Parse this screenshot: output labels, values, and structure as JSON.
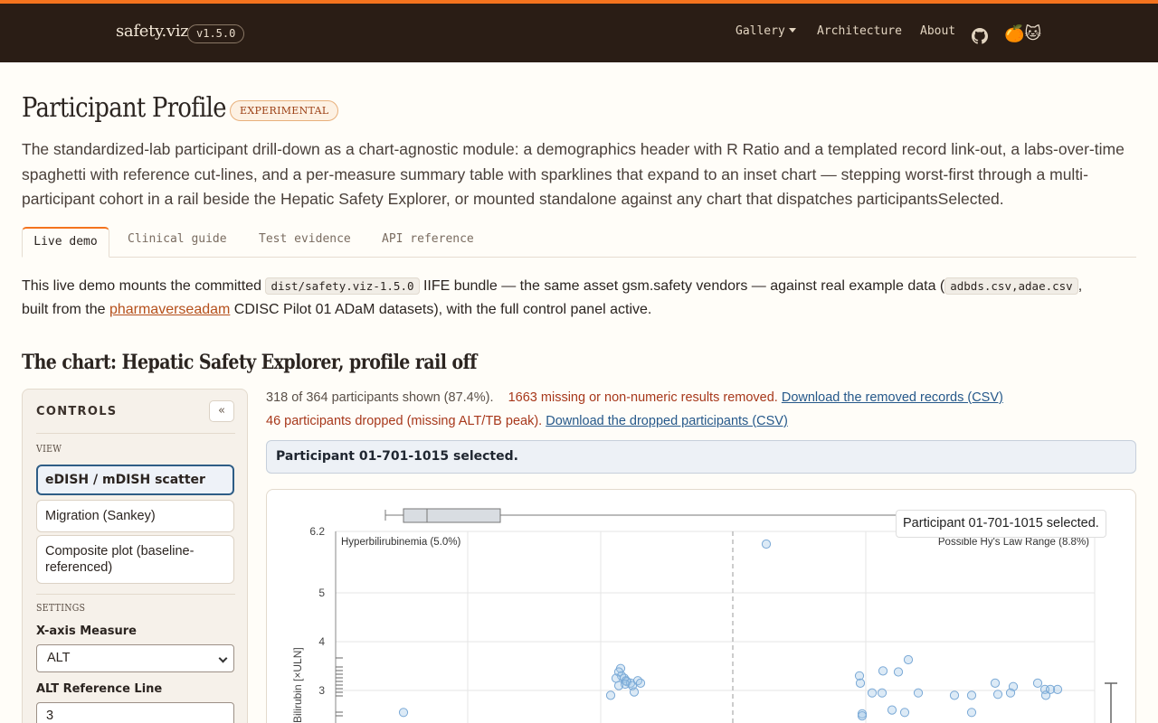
{
  "nav": {
    "brand": "safety.viz",
    "version": "v1.5.0",
    "links": [
      "Gallery",
      "Architecture",
      "About"
    ],
    "github_icon": "github-icon",
    "emoji": "🍊🐱"
  },
  "header": {
    "title": "Participant Profile",
    "badge": "EXPERIMENTAL",
    "lede": "The standardized-lab participant drill-down as a chart-agnostic module: a demographics header with R Ratio and a templated record link-out, a labs-over-time spaghetti with reference cut-lines, and a per-measure summary table with sparklines that expand to an inset chart — stepping worst-first through a multi-participant cohort in a rail beside the Hepatic Safety Explorer, or mounted standalone against any chart that dispatches participantsSelected."
  },
  "tabs": [
    "Live demo",
    "Clinical guide",
    "Test evidence",
    "API reference"
  ],
  "intro": {
    "p1_a": "This live demo mounts the committed",
    "code1": "dist/safety.viz-1.5.0",
    "p1_b": "IIFE bundle — the same asset gsm.safety vendors — against real example data (",
    "code2": "adbds.csv,adae.csv",
    "p1_c": ",",
    "p2_a": "built from the",
    "link": "pharmaverseadam",
    "p2_b": "CDISC Pilot 01 ADaM datasets), with the full control panel active."
  },
  "section_title": "The chart: Hepatic Safety Explorer, profile rail off",
  "controls": {
    "title": "CONTROLS",
    "collapse": "«",
    "view_label": "VIEW",
    "views": [
      "eDISH / mDISH scatter",
      "Migration (Sankey)",
      "Composite plot (baseline-referenced)"
    ],
    "settings_label": "SETTINGS",
    "x_measure_label": "X-axis Measure",
    "x_measure_value": "ALT",
    "alt_ref_label": "ALT Reference Line",
    "alt_ref_value": "3"
  },
  "status": {
    "shown": "318 of 364 participants shown (87.4%).",
    "removed_count": "1663",
    "removed_text": "missing or non-numeric results removed.",
    "removed_link": "Download the removed records (CSV)",
    "dropped_text": "46 participants dropped (missing ALT/TB peak).",
    "dropped_link": "Download the dropped participants (CSV)"
  },
  "selected_banner": "Participant 01-701-1015 selected.",
  "chart_data": {
    "type": "scatter",
    "tooltip": "Participant 01-701-1015 selected.",
    "ylabel": "Bilirubin [×ULN]",
    "y_ticks": [
      "6.2",
      "5",
      "4",
      "3"
    ],
    "y_range_visible": [
      2.5,
      6.2
    ],
    "quadrant_labels": {
      "top_left": "Hyperbilirubinemia (5.0%)",
      "top_right": "Possible Hy's Law Range (8.8%)"
    },
    "point_color": "#9cc3e6",
    "points": [
      {
        "col": "A",
        "y": 2.55
      },
      {
        "col": "B",
        "y": 3.45
      },
      {
        "col": "B",
        "y": 3.38
      },
      {
        "col": "B",
        "y": 3.3
      },
      {
        "col": "B",
        "y": 3.25
      },
      {
        "col": "B",
        "y": 3.2
      },
      {
        "col": "B",
        "y": 3.18
      },
      {
        "col": "B",
        "y": 3.15
      },
      {
        "col": "B",
        "y": 3.13
      },
      {
        "col": "B",
        "y": 3.1
      },
      {
        "col": "B",
        "y": 3.1
      },
      {
        "col": "B",
        "y": 2.97
      },
      {
        "col": "B",
        "y": 2.9
      },
      {
        "col": "B",
        "y": 3.25
      },
      {
        "col": "B",
        "y": 3.2
      },
      {
        "col": "B",
        "y": 3.15
      },
      {
        "col": "C",
        "y": 6.0
      },
      {
        "col": "D",
        "y": 3.3
      },
      {
        "col": "D",
        "y": 3.15
      },
      {
        "col": "D",
        "y": 2.95
      },
      {
        "col": "D",
        "y": 3.4
      },
      {
        "col": "D",
        "y": 3.38
      },
      {
        "col": "D",
        "y": 3.63
      },
      {
        "col": "D",
        "y": 2.95
      },
      {
        "col": "D",
        "y": 2.6
      },
      {
        "col": "D",
        "y": 2.52
      },
      {
        "col": "D",
        "y": 2.48
      },
      {
        "col": "D",
        "y": 2.55
      },
      {
        "col": "D",
        "y": 2.95
      },
      {
        "col": "D",
        "y": 2.9
      },
      {
        "col": "D",
        "y": 2.55
      },
      {
        "col": "D",
        "y": 2.9
      },
      {
        "col": "D",
        "y": 3.15
      },
      {
        "col": "D",
        "y": 2.92
      },
      {
        "col": "D",
        "y": 3.08
      },
      {
        "col": "D",
        "y": 3.15
      },
      {
        "col": "D",
        "y": 3.02
      },
      {
        "col": "D",
        "y": 2.95
      },
      {
        "col": "D",
        "y": 3.02
      },
      {
        "col": "D",
        "y": 3.02
      },
      {
        "col": "D",
        "y": 2.9
      }
    ]
  }
}
